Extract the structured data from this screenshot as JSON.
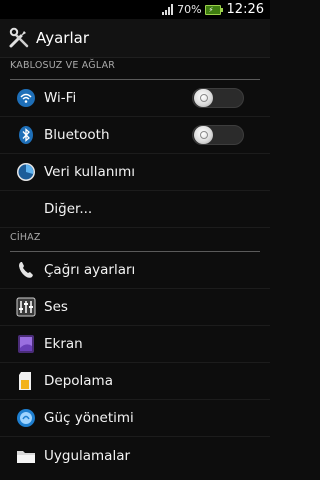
{
  "status": {
    "battery_percent": "70%",
    "time": "12:26"
  },
  "header": {
    "title": "Ayarlar"
  },
  "sections": {
    "wireless": {
      "title": "KABLOSUZ VE AĞLAR"
    },
    "device": {
      "title": "CİHAZ"
    }
  },
  "items": {
    "wifi": {
      "label": "Wi-Fi",
      "toggle": "off"
    },
    "bluetooth": {
      "label": "Bluetooth",
      "toggle": "off"
    },
    "data_usage": {
      "label": "Veri kullanımı"
    },
    "more": {
      "label": "Diğer..."
    },
    "call": {
      "label": "Çağrı ayarları"
    },
    "sound": {
      "label": "Ses"
    },
    "display": {
      "label": "Ekran"
    },
    "storage": {
      "label": "Depolama"
    },
    "power": {
      "label": "Güç yönetimi"
    },
    "apps": {
      "label": "Uygulamalar"
    }
  },
  "colors": {
    "background": "#0d0d0d",
    "accent": "#2f8fd8",
    "battery": "#9bd14b"
  }
}
